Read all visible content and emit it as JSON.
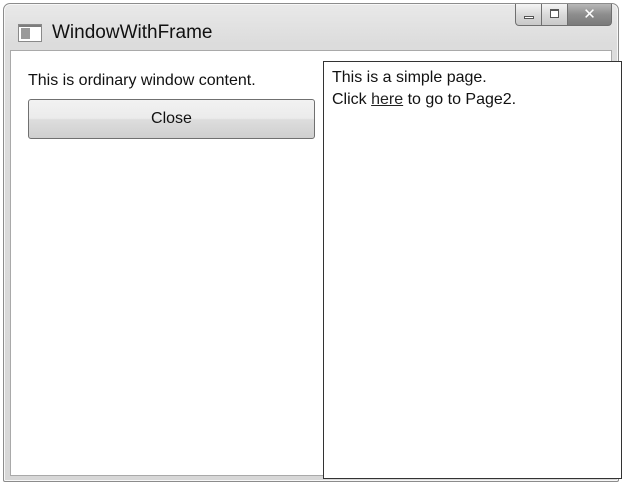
{
  "window": {
    "title": "WindowWithFrame",
    "icon": "window-app-icon",
    "caption_buttons": {
      "minimize_icon": "minimize-icon",
      "maximize_icon": "maximize-icon",
      "close_icon": "close-icon",
      "close_glyph": "✕"
    }
  },
  "main": {
    "content_text": "This is ordinary window content.",
    "close_button_label": "Close"
  },
  "frame": {
    "page_text": "This is a simple page.",
    "link_prefix": "Click ",
    "link_text": "here",
    "link_suffix": " to go to Page2."
  }
}
